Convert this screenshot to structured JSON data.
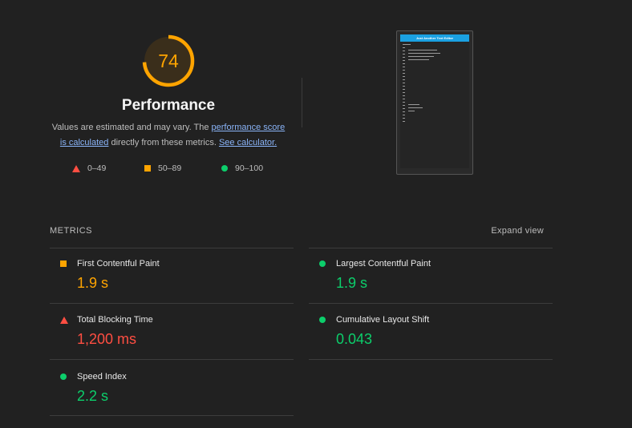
{
  "score": {
    "value": "74",
    "fraction": 0.74,
    "color": "#ffa400"
  },
  "category": {
    "title": "Performance"
  },
  "description": {
    "part1": "Values are estimated and may vary. The ",
    "link1": "performance score is calculated",
    "part2": " directly from these metrics. ",
    "link2": "See calculator."
  },
  "legend": [
    {
      "range": "0–49",
      "shape": "triangle",
      "color": "#ff4e42"
    },
    {
      "range": "50–89",
      "shape": "square",
      "color": "#ffa400"
    },
    {
      "range": "90–100",
      "shape": "circle",
      "color": "#0cce6b"
    }
  ],
  "screenshot": {
    "app_title": "Just Another Text Editor"
  },
  "metrics_section": {
    "header": "METRICS",
    "expand_label": "Expand view"
  },
  "metrics": [
    {
      "name": "First Contentful Paint",
      "value": "1.9 s",
      "rating": "average"
    },
    {
      "name": "Largest Contentful Paint",
      "value": "1.9 s",
      "rating": "pass"
    },
    {
      "name": "Total Blocking Time",
      "value": "1,200 ms",
      "rating": "fail"
    },
    {
      "name": "Cumulative Layout Shift",
      "value": "0.043",
      "rating": "pass"
    },
    {
      "name": "Speed Index",
      "value": "2.2 s",
      "rating": "pass"
    }
  ]
}
